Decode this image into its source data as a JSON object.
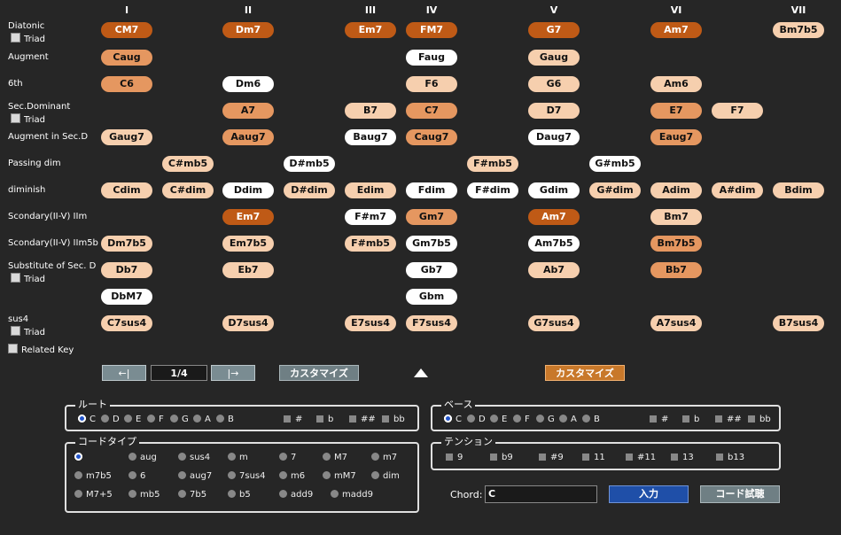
{
  "columns": [
    "I",
    "II",
    "III",
    "IV",
    "V",
    "VI",
    "VII"
  ],
  "rows": [
    {
      "label": "Diatonic",
      "triad": "Triad"
    },
    {
      "label": "Augment"
    },
    {
      "label": "6th"
    },
    {
      "label": "Sec.Dominant",
      "triad": "Triad"
    },
    {
      "label": "Augment in Sec.D"
    },
    {
      "label": "Passing dim"
    },
    {
      "label": "diminish"
    },
    {
      "label": "Scondary(II-V) IIm"
    },
    {
      "label": "Scondary(II-V) IIm5b"
    },
    {
      "label": "Substitute of Sec. D",
      "triad": "Triad"
    },
    {
      "label": ""
    },
    {
      "label": "sus4",
      "triad": "Triad"
    }
  ],
  "related_key": "Related Key",
  "chords": [
    {
      "name": "CM7",
      "row": 0,
      "col": 0,
      "color": "dk"
    },
    {
      "name": "Dm7",
      "row": 0,
      "col": 2,
      "color": "dk"
    },
    {
      "name": "Em7",
      "row": 0,
      "col": 4,
      "color": "dk"
    },
    {
      "name": "FM7",
      "row": 0,
      "col": 5,
      "color": "dk"
    },
    {
      "name": "G7",
      "row": 0,
      "col": 7,
      "color": "dk"
    },
    {
      "name": "Am7",
      "row": 0,
      "col": 9,
      "color": "dk"
    },
    {
      "name": "Bm7b5",
      "row": 0,
      "col": 11,
      "color": "lt"
    },
    {
      "name": "Caug",
      "row": 1,
      "col": 0,
      "color": "md"
    },
    {
      "name": "Faug",
      "row": 1,
      "col": 5,
      "color": "wh"
    },
    {
      "name": "Gaug",
      "row": 1,
      "col": 7,
      "color": "lt"
    },
    {
      "name": "C6",
      "row": 2,
      "col": 0,
      "color": "md"
    },
    {
      "name": "Dm6",
      "row": 2,
      "col": 2,
      "color": "wh"
    },
    {
      "name": "F6",
      "row": 2,
      "col": 5,
      "color": "lt"
    },
    {
      "name": "G6",
      "row": 2,
      "col": 7,
      "color": "lt"
    },
    {
      "name": "Am6",
      "row": 2,
      "col": 9,
      "color": "lt"
    },
    {
      "name": "A7",
      "row": 3,
      "col": 2,
      "color": "md"
    },
    {
      "name": "B7",
      "row": 3,
      "col": 4,
      "color": "lt"
    },
    {
      "name": "C7",
      "row": 3,
      "col": 5,
      "color": "md"
    },
    {
      "name": "D7",
      "row": 3,
      "col": 7,
      "color": "lt"
    },
    {
      "name": "E7",
      "row": 3,
      "col": 9,
      "color": "md"
    },
    {
      "name": "F7",
      "row": 3,
      "col": 10,
      "color": "lt"
    },
    {
      "name": "Gaug7",
      "row": 4,
      "col": 0,
      "color": "lt"
    },
    {
      "name": "Aaug7",
      "row": 4,
      "col": 2,
      "color": "md"
    },
    {
      "name": "Baug7",
      "row": 4,
      "col": 4,
      "color": "wh"
    },
    {
      "name": "Caug7",
      "row": 4,
      "col": 5,
      "color": "md"
    },
    {
      "name": "Daug7",
      "row": 4,
      "col": 7,
      "color": "wh"
    },
    {
      "name": "Eaug7",
      "row": 4,
      "col": 9,
      "color": "md"
    },
    {
      "name": "C#mb5",
      "row": 5,
      "col": 1,
      "color": "lt"
    },
    {
      "name": "D#mb5",
      "row": 5,
      "col": 3,
      "color": "wh"
    },
    {
      "name": "F#mb5",
      "row": 5,
      "col": 6,
      "color": "lt"
    },
    {
      "name": "G#mb5",
      "row": 5,
      "col": 8,
      "color": "wh"
    },
    {
      "name": "Cdim",
      "row": 6,
      "col": 0,
      "color": "lt"
    },
    {
      "name": "C#dim",
      "row": 6,
      "col": 1,
      "color": "lt"
    },
    {
      "name": "Ddim",
      "row": 6,
      "col": 2,
      "color": "wh"
    },
    {
      "name": "D#dim",
      "row": 6,
      "col": 3,
      "color": "lt"
    },
    {
      "name": "Edim",
      "row": 6,
      "col": 4,
      "color": "lt"
    },
    {
      "name": "Fdim",
      "row": 6,
      "col": 5,
      "color": "wh"
    },
    {
      "name": "F#dim",
      "row": 6,
      "col": 6,
      "color": "wh"
    },
    {
      "name": "Gdim",
      "row": 6,
      "col": 7,
      "color": "wh"
    },
    {
      "name": "G#dim",
      "row": 6,
      "col": 8,
      "color": "lt"
    },
    {
      "name": "Adim",
      "row": 6,
      "col": 9,
      "color": "lt"
    },
    {
      "name": "A#dim",
      "row": 6,
      "col": 10,
      "color": "lt"
    },
    {
      "name": "Bdim",
      "row": 6,
      "col": 11,
      "color": "lt"
    },
    {
      "name": "Em7",
      "row": 7,
      "col": 2,
      "color": "dk"
    },
    {
      "name": "F#m7",
      "row": 7,
      "col": 4,
      "color": "wh"
    },
    {
      "name": "Gm7",
      "row": 7,
      "col": 5,
      "color": "md"
    },
    {
      "name": "Am7",
      "row": 7,
      "col": 7,
      "color": "dk"
    },
    {
      "name": "Bm7",
      "row": 7,
      "col": 9,
      "color": "lt"
    },
    {
      "name": "Dm7b5",
      "row": 8,
      "col": 0,
      "color": "lt"
    },
    {
      "name": "Em7b5",
      "row": 8,
      "col": 2,
      "color": "lt"
    },
    {
      "name": "F#mb5",
      "row": 8,
      "col": 4,
      "color": "lt"
    },
    {
      "name": "Gm7b5",
      "row": 8,
      "col": 5,
      "color": "wh"
    },
    {
      "name": "Am7b5",
      "row": 8,
      "col": 7,
      "color": "wh"
    },
    {
      "name": "Bm7b5",
      "row": 8,
      "col": 9,
      "color": "md"
    },
    {
      "name": "Db7",
      "row": 9,
      "col": 0,
      "color": "lt"
    },
    {
      "name": "Eb7",
      "row": 9,
      "col": 2,
      "color": "lt"
    },
    {
      "name": "Gb7",
      "row": 9,
      "col": 5,
      "color": "wh"
    },
    {
      "name": "Ab7",
      "row": 9,
      "col": 7,
      "color": "lt"
    },
    {
      "name": "Bb7",
      "row": 9,
      "col": 9,
      "color": "md"
    },
    {
      "name": "DbM7",
      "row": 10,
      "col": 0,
      "color": "wh"
    },
    {
      "name": "Gbm",
      "row": 10,
      "col": 5,
      "color": "wh"
    },
    {
      "name": "C7sus4",
      "row": 11,
      "col": 0,
      "color": "lt"
    },
    {
      "name": "D7sus4",
      "row": 11,
      "col": 2,
      "color": "lt"
    },
    {
      "name": "E7sus4",
      "row": 11,
      "col": 4,
      "color": "lt"
    },
    {
      "name": "F7sus4",
      "row": 11,
      "col": 5,
      "color": "lt"
    },
    {
      "name": "G7sus4",
      "row": 11,
      "col": 7,
      "color": "lt"
    },
    {
      "name": "A7sus4",
      "row": 11,
      "col": 9,
      "color": "lt"
    },
    {
      "name": "B7sus4",
      "row": 11,
      "col": 11,
      "color": "lt"
    }
  ],
  "toolbar": {
    "prev": "←|",
    "page": "1/4",
    "next": "|→",
    "customize_left": "カスタマイズ",
    "customize_right": "カスタマイズ"
  },
  "root_group": {
    "title": "ルート",
    "notes": [
      "C",
      "D",
      "E",
      "F",
      "G",
      "A",
      "B"
    ],
    "selected": "C",
    "accidentals": [
      "#",
      "b",
      "##",
      "bb"
    ]
  },
  "bass_group": {
    "title": "ベース",
    "notes": [
      "C",
      "D",
      "E",
      "F",
      "G",
      "A",
      "B"
    ],
    "selected": "C",
    "accidentals": [
      "#",
      "b",
      "##",
      "bb"
    ]
  },
  "chordtype_group": {
    "title": "コードタイプ",
    "rows": [
      [
        "",
        "aug",
        "sus4",
        "m",
        "7",
        "M7",
        "m7"
      ],
      [
        "m7b5",
        "6",
        "aug7",
        "7sus4",
        "m6",
        "mM7",
        "dim"
      ],
      [
        "M7+5",
        "mb5",
        "7b5",
        "b5",
        "add9",
        "madd9"
      ]
    ]
  },
  "tension_group": {
    "title": "テンション",
    "options": [
      "9",
      "b9",
      "#9",
      "11",
      "#11",
      "13",
      "b13"
    ]
  },
  "chord_field": {
    "label": "Chord:",
    "value": "C"
  },
  "input_button": "入力",
  "preview_button": "コード試聴",
  "colors": {
    "dark": "#bf5a16",
    "medium": "#e59760",
    "light": "#f6cfae",
    "white": "#ffffff",
    "background": "#262626"
  }
}
